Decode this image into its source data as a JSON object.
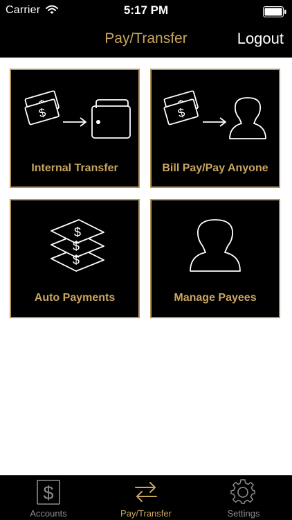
{
  "status_bar": {
    "carrier": "Carrier",
    "time": "5:17 PM",
    "wifi_icon": "wifi-icon",
    "battery_icon": "battery-icon"
  },
  "nav": {
    "title": "Pay/Transfer",
    "logout_label": "Logout"
  },
  "tiles": [
    {
      "label": "Internal Transfer",
      "icon": "money-to-wallet-icon"
    },
    {
      "label": "Bill Pay/Pay Anyone",
      "icon": "money-to-person-icon"
    },
    {
      "label": "Auto Payments",
      "icon": "stacked-bills-icon"
    },
    {
      "label": "Manage Payees",
      "icon": "person-silhouette-icon"
    }
  ],
  "tab_bar": {
    "items": [
      {
        "label": "Accounts",
        "icon": "dollar-document-icon",
        "active": false
      },
      {
        "label": "Pay/Transfer",
        "icon": "transfer-arrows-icon",
        "active": true
      },
      {
        "label": "Settings",
        "icon": "gear-icon",
        "active": false
      }
    ]
  },
  "colors": {
    "accent_gold": "#c9a560",
    "tile_border": "#b5935b",
    "bar_background": "#000000",
    "inactive_tab": "#8c8c8c"
  }
}
